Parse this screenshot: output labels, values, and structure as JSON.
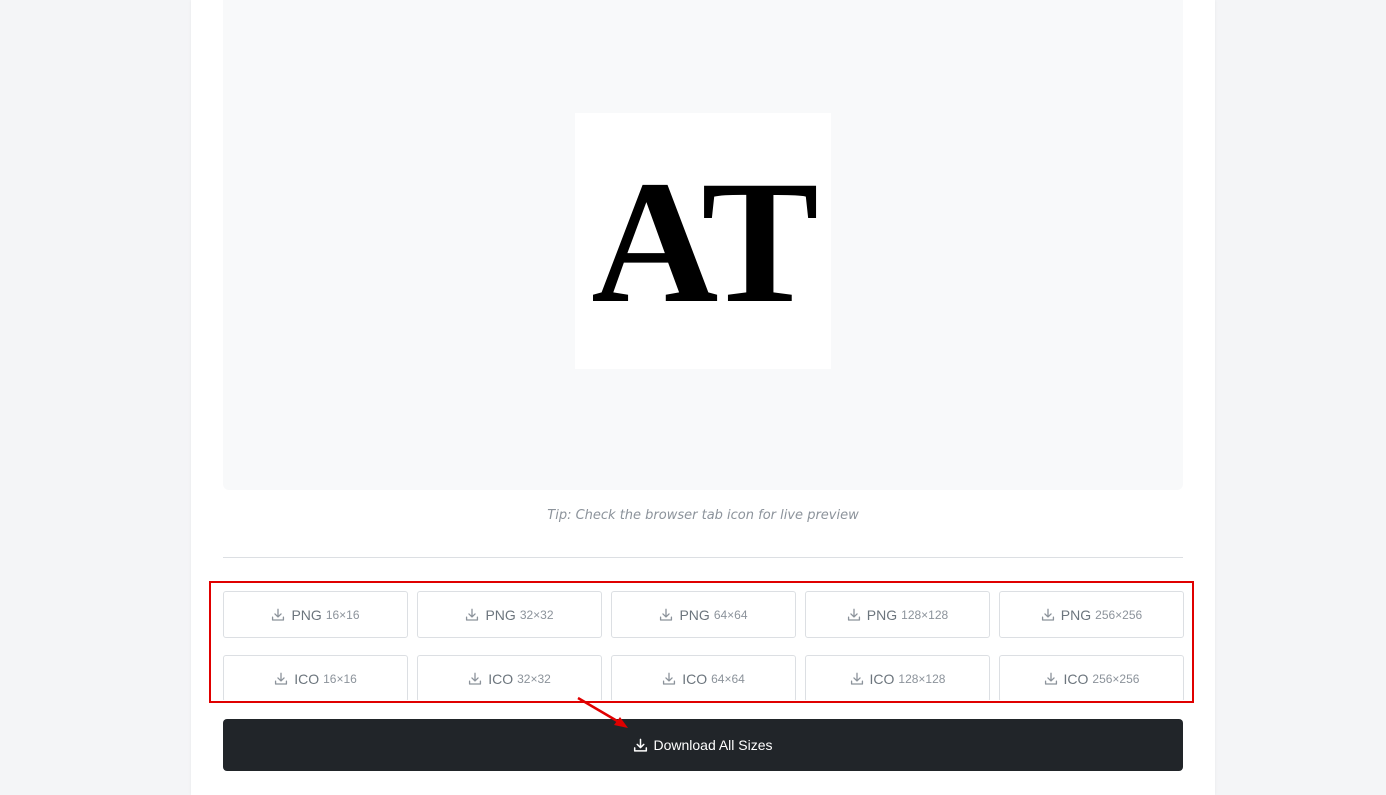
{
  "preview": {
    "icon_text": "AT"
  },
  "tip": "Tip: Check the browser tab icon for live preview",
  "downloads": [
    {
      "format": "PNG",
      "size": "16×16"
    },
    {
      "format": "PNG",
      "size": "32×32"
    },
    {
      "format": "PNG",
      "size": "64×64"
    },
    {
      "format": "PNG",
      "size": "128×128"
    },
    {
      "format": "PNG",
      "size": "256×256"
    },
    {
      "format": "ICO",
      "size": "16×16"
    },
    {
      "format": "ICO",
      "size": "32×32"
    },
    {
      "format": "ICO",
      "size": "64×64"
    },
    {
      "format": "ICO",
      "size": "128×128"
    },
    {
      "format": "ICO",
      "size": "256×256"
    }
  ],
  "download_all": {
    "label": "Download All Sizes"
  },
  "colors": {
    "annotation": "#e00000",
    "primary_button": "#212529"
  },
  "icons": {
    "download": "download-icon"
  }
}
